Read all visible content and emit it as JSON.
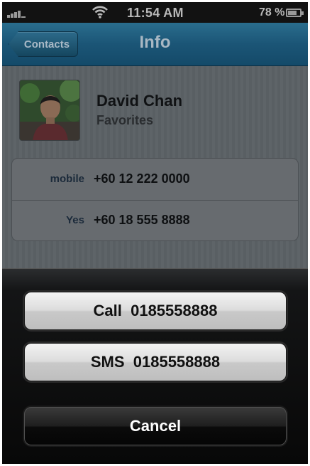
{
  "status_bar": {
    "time": "11:54 AM",
    "battery": "78 %",
    "battery_level": 0.78,
    "signal_icon": "signal-bars-icon",
    "wifi_icon": "wifi-icon",
    "battery_icon": "battery-icon"
  },
  "nav": {
    "back_label": "Contacts",
    "title": "Info"
  },
  "contact": {
    "name": "David Chan",
    "group": "Favorites",
    "phones": [
      {
        "label": "mobile",
        "number": "+60 12 222 0000"
      },
      {
        "label": "Yes",
        "number": "+60 18 555 8888"
      }
    ]
  },
  "action_sheet": {
    "call_label": "Call  0185558888",
    "sms_label": "SMS  0185558888",
    "cancel_label": "Cancel"
  },
  "colors": {
    "nav_bar": "#1b5576",
    "overlay_dim": "#5e6468",
    "light_button": "#dcdcdc",
    "dark_button": "#1e1e1e"
  }
}
